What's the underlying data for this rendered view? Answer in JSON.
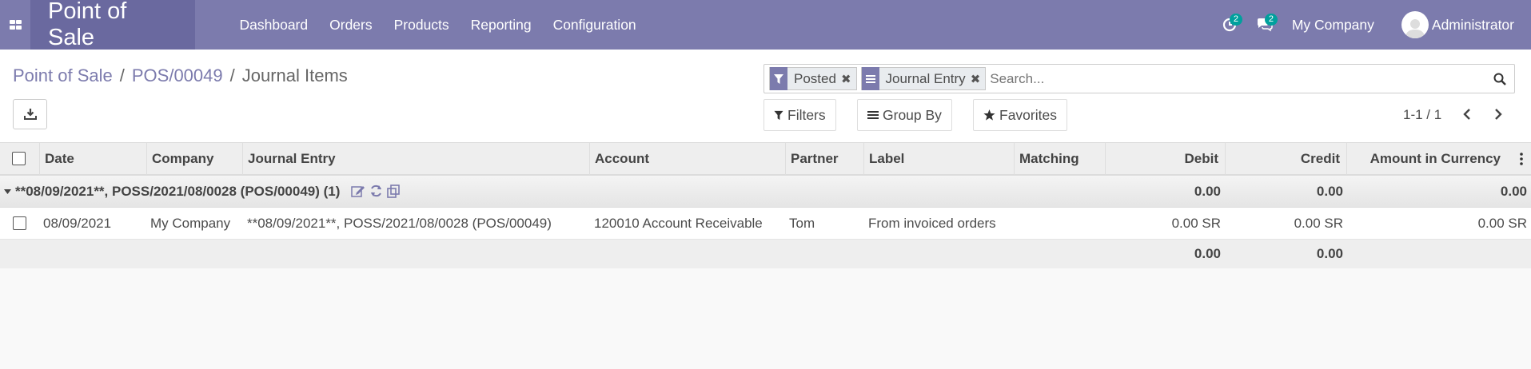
{
  "navbar": {
    "app_name": "Point of Sale",
    "menu": [
      "Dashboard",
      "Orders",
      "Products",
      "Reporting",
      "Configuration"
    ],
    "activity_count": "2",
    "messages_count": "2",
    "company": "My Company",
    "user": "Administrator"
  },
  "breadcrumb": {
    "items": [
      "Point of Sale",
      "POS/00049"
    ],
    "separator": "/",
    "current": "Journal Items"
  },
  "search": {
    "facets": [
      {
        "icon": "filter-icon",
        "value": "Posted"
      },
      {
        "icon": "group-by-icon",
        "value": "Journal Entry"
      }
    ],
    "placeholder": "Search..."
  },
  "buttons": {
    "filters": "Filters",
    "group_by": "Group By",
    "favorites": "Favorites"
  },
  "pager": {
    "value": "1-1 / 1"
  },
  "table": {
    "columns": [
      "Date",
      "Company",
      "Journal Entry",
      "Account",
      "Partner",
      "Label",
      "Matching",
      "Debit",
      "Credit",
      "Amount in Currency"
    ],
    "group": {
      "label": "**08/09/2021**, POSS/2021/08/0028 (POS/00049) (1)",
      "debit": "0.00",
      "credit": "0.00",
      "amount_currency": "0.00"
    },
    "rows": [
      {
        "date": "08/09/2021",
        "company": "My Company",
        "journal_entry": "**08/09/2021**, POSS/2021/08/0028 (POS/00049)",
        "account": "120010 Account Receivable",
        "partner": "Tom",
        "label": "From invoiced orders",
        "matching": "",
        "debit": "0.00 SR",
        "credit": "0.00 SR",
        "amount_currency": "0.00 SR"
      }
    ],
    "totals": {
      "debit": "0.00",
      "credit": "0.00"
    }
  },
  "colors": {
    "navbar": "#7c7bad",
    "brand_bg": "#6a699f",
    "badge": "#00a09d",
    "link": "#7c7bad"
  }
}
